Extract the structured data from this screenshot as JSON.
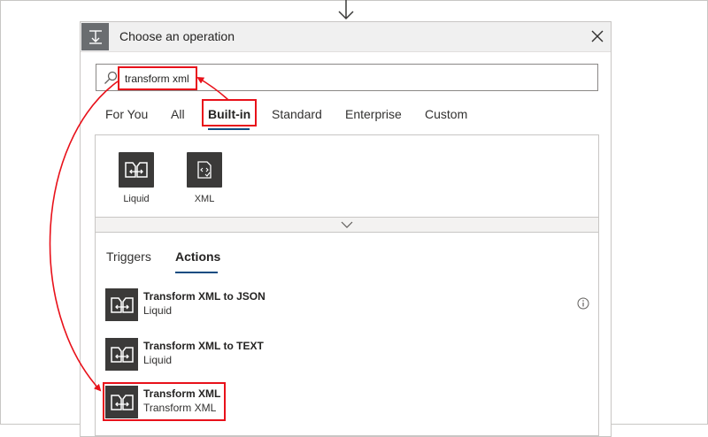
{
  "dialog": {
    "title": "Choose an operation"
  },
  "search": {
    "value": "transform xml"
  },
  "tabs": [
    {
      "label": "For You"
    },
    {
      "label": "All"
    },
    {
      "label": "Built-in"
    },
    {
      "label": "Standard"
    },
    {
      "label": "Enterprise"
    },
    {
      "label": "Custom"
    }
  ],
  "selected_tab": "Built-in",
  "connectors": [
    {
      "label": "Liquid",
      "icon": "liquid-icon"
    },
    {
      "label": "XML",
      "icon": "xml-icon"
    }
  ],
  "subtabs": [
    {
      "label": "Triggers"
    },
    {
      "label": "Actions"
    }
  ],
  "selected_subtab": "Actions",
  "actions": [
    {
      "name": "Transform XML to JSON",
      "connector": "Liquid",
      "has_info": true
    },
    {
      "name": "Transform XML to TEXT",
      "connector": "Liquid",
      "has_info": false
    },
    {
      "name": "Transform XML",
      "connector": "Transform XML",
      "has_info": false
    }
  ],
  "colors": {
    "accent_underline": "#0f4c81",
    "annotation_red": "#e8111a",
    "tile_dark": "#3b3a39",
    "header_bg": "#f0f0f0"
  }
}
